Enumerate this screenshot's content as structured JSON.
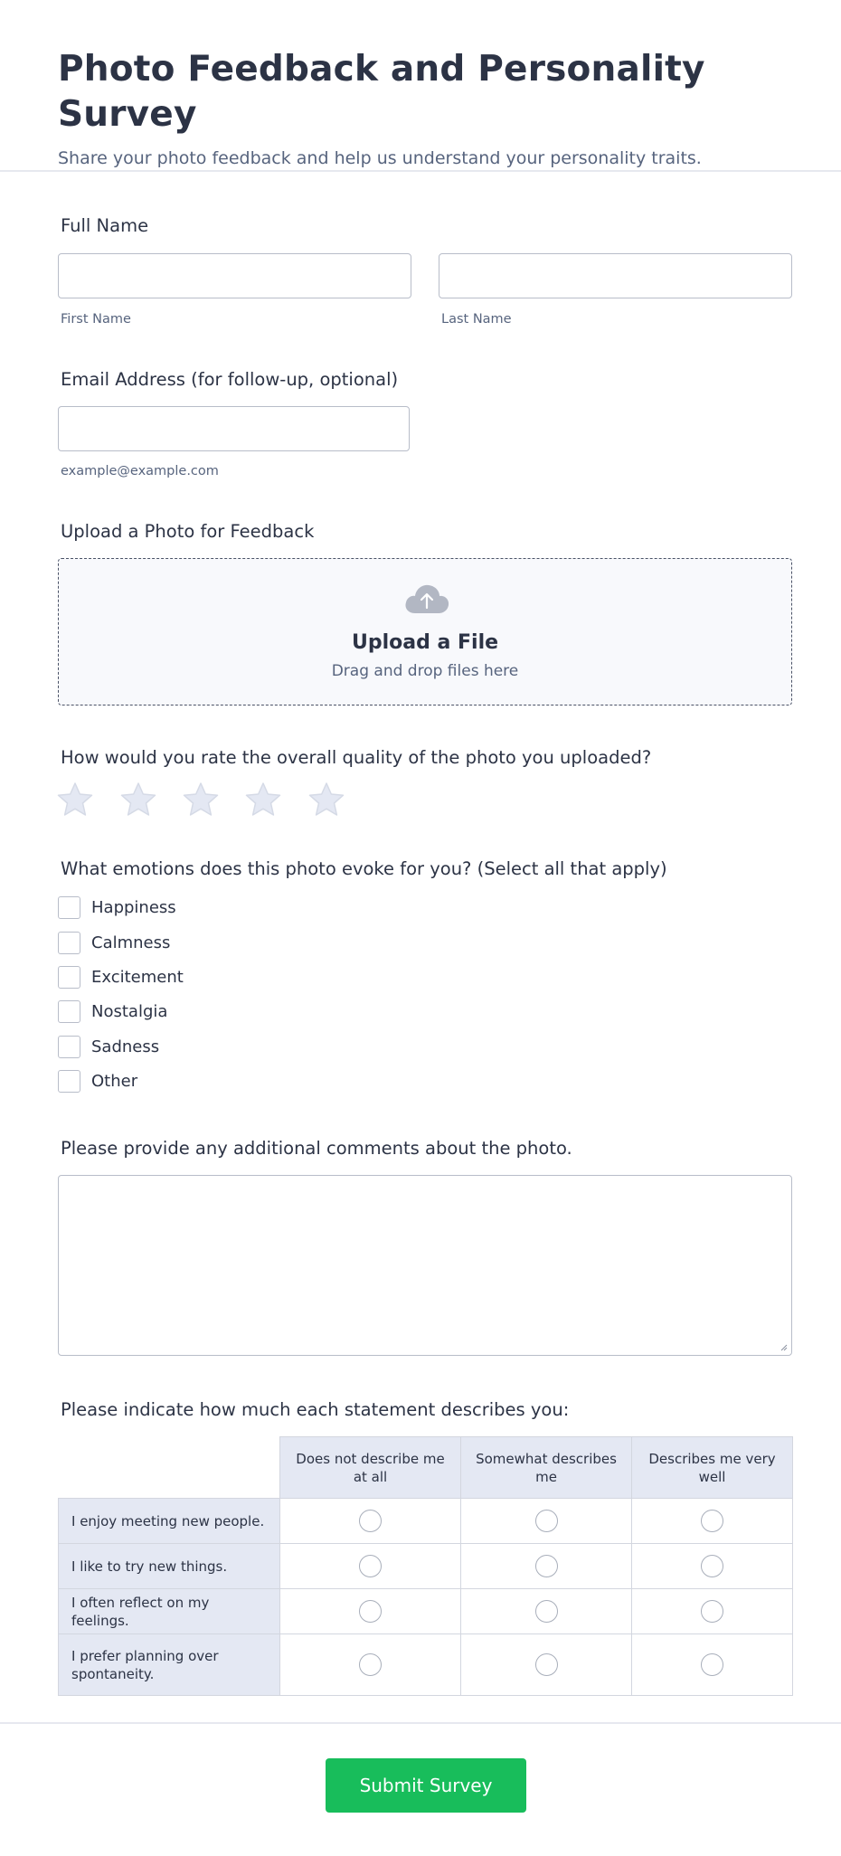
{
  "header": {
    "title": "Photo Feedback and Personality Survey",
    "subtitle": "Share your photo feedback and help us understand your personality traits."
  },
  "full_name": {
    "label": "Full Name",
    "first_sublabel": "First Name",
    "last_sublabel": "Last Name",
    "first_value": "",
    "last_value": ""
  },
  "email": {
    "label": "Email Address (for follow-up, optional)",
    "sublabel": "example@example.com",
    "value": ""
  },
  "upload": {
    "label": "Upload a Photo for Feedback",
    "title": "Upload a File",
    "hint": "Drag and drop files here",
    "icon": "cloud-upload-icon"
  },
  "rating": {
    "label": "How would you rate the overall quality of the photo you uploaded?",
    "max": 5,
    "value": 0
  },
  "emotions": {
    "label": "What emotions does this photo evoke for you? (Select all that apply)",
    "options": [
      "Happiness",
      "Calmness",
      "Excitement",
      "Nostalgia",
      "Sadness",
      "Other"
    ]
  },
  "comments": {
    "label": "Please provide any additional comments about the photo.",
    "value": ""
  },
  "matrix": {
    "label": "Please indicate how much each statement describes you:",
    "columns": [
      "Does not describe me at all",
      "Somewhat describes me",
      "Describes me very well"
    ],
    "rows": [
      "I enjoy meeting new people.",
      "I like to try new things.",
      "I often reflect on my feelings.",
      "I prefer planning over spontaneity."
    ]
  },
  "submit": {
    "label": "Submit Survey"
  },
  "colors": {
    "text": "#2c3345",
    "muted": "#57647e",
    "border": "#b8bdc9",
    "submit": "#18bd5b",
    "star": "#e4e8f3"
  }
}
